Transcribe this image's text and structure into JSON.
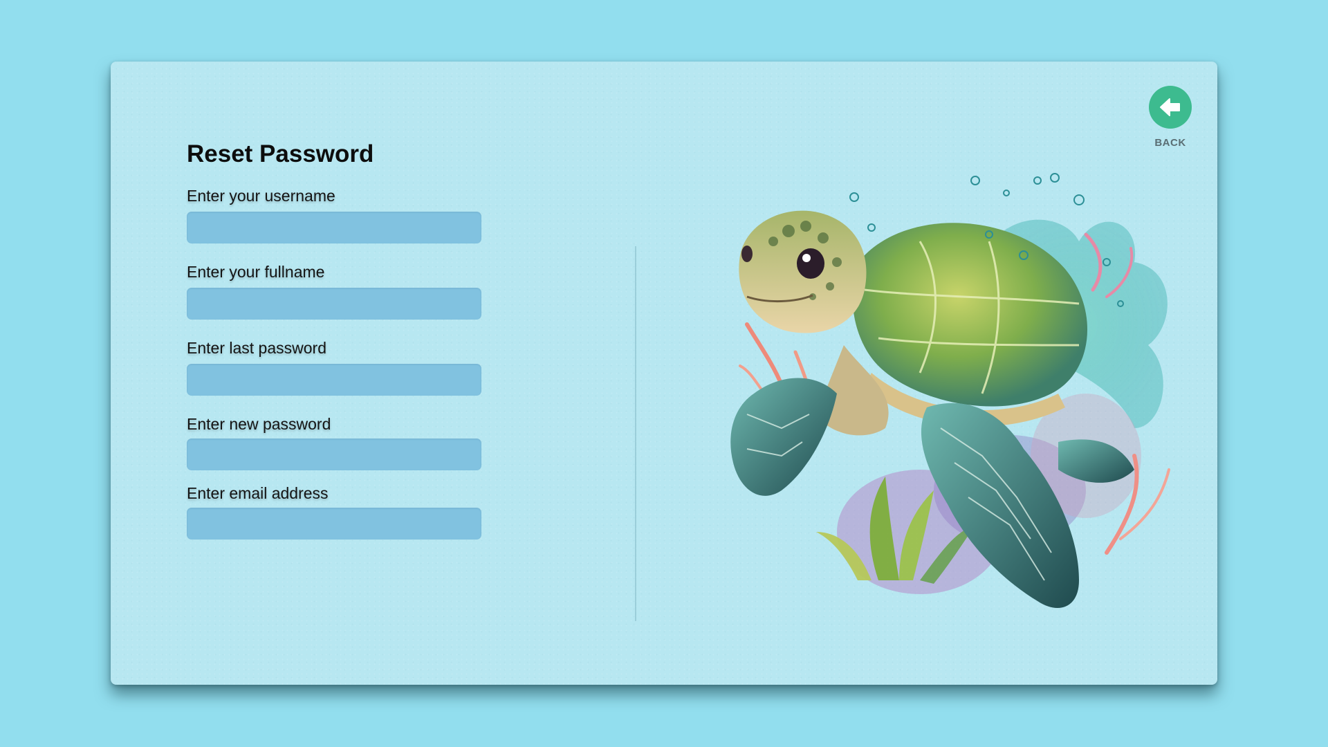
{
  "form": {
    "title": "Reset Password",
    "fields": [
      {
        "label": "Enter your username",
        "value": "",
        "placeholder": ""
      },
      {
        "label": "Enter your fullname",
        "value": "",
        "placeholder": ""
      },
      {
        "label": "Enter last password",
        "value": "",
        "placeholder": ""
      },
      {
        "label": "Enter new password",
        "value": "",
        "placeholder": ""
      },
      {
        "label": "Enter email address",
        "value": "",
        "placeholder": ""
      }
    ]
  },
  "back": {
    "label": "BACK",
    "icon": "arrow-left-icon"
  },
  "illustration": {
    "subject": "sea-turtle-illustration"
  },
  "colors": {
    "background": "#92deee",
    "card": "#b7e7f1",
    "input": "#81c2e0",
    "accent": "#3dbb8f",
    "title": "#0d0d0d"
  }
}
